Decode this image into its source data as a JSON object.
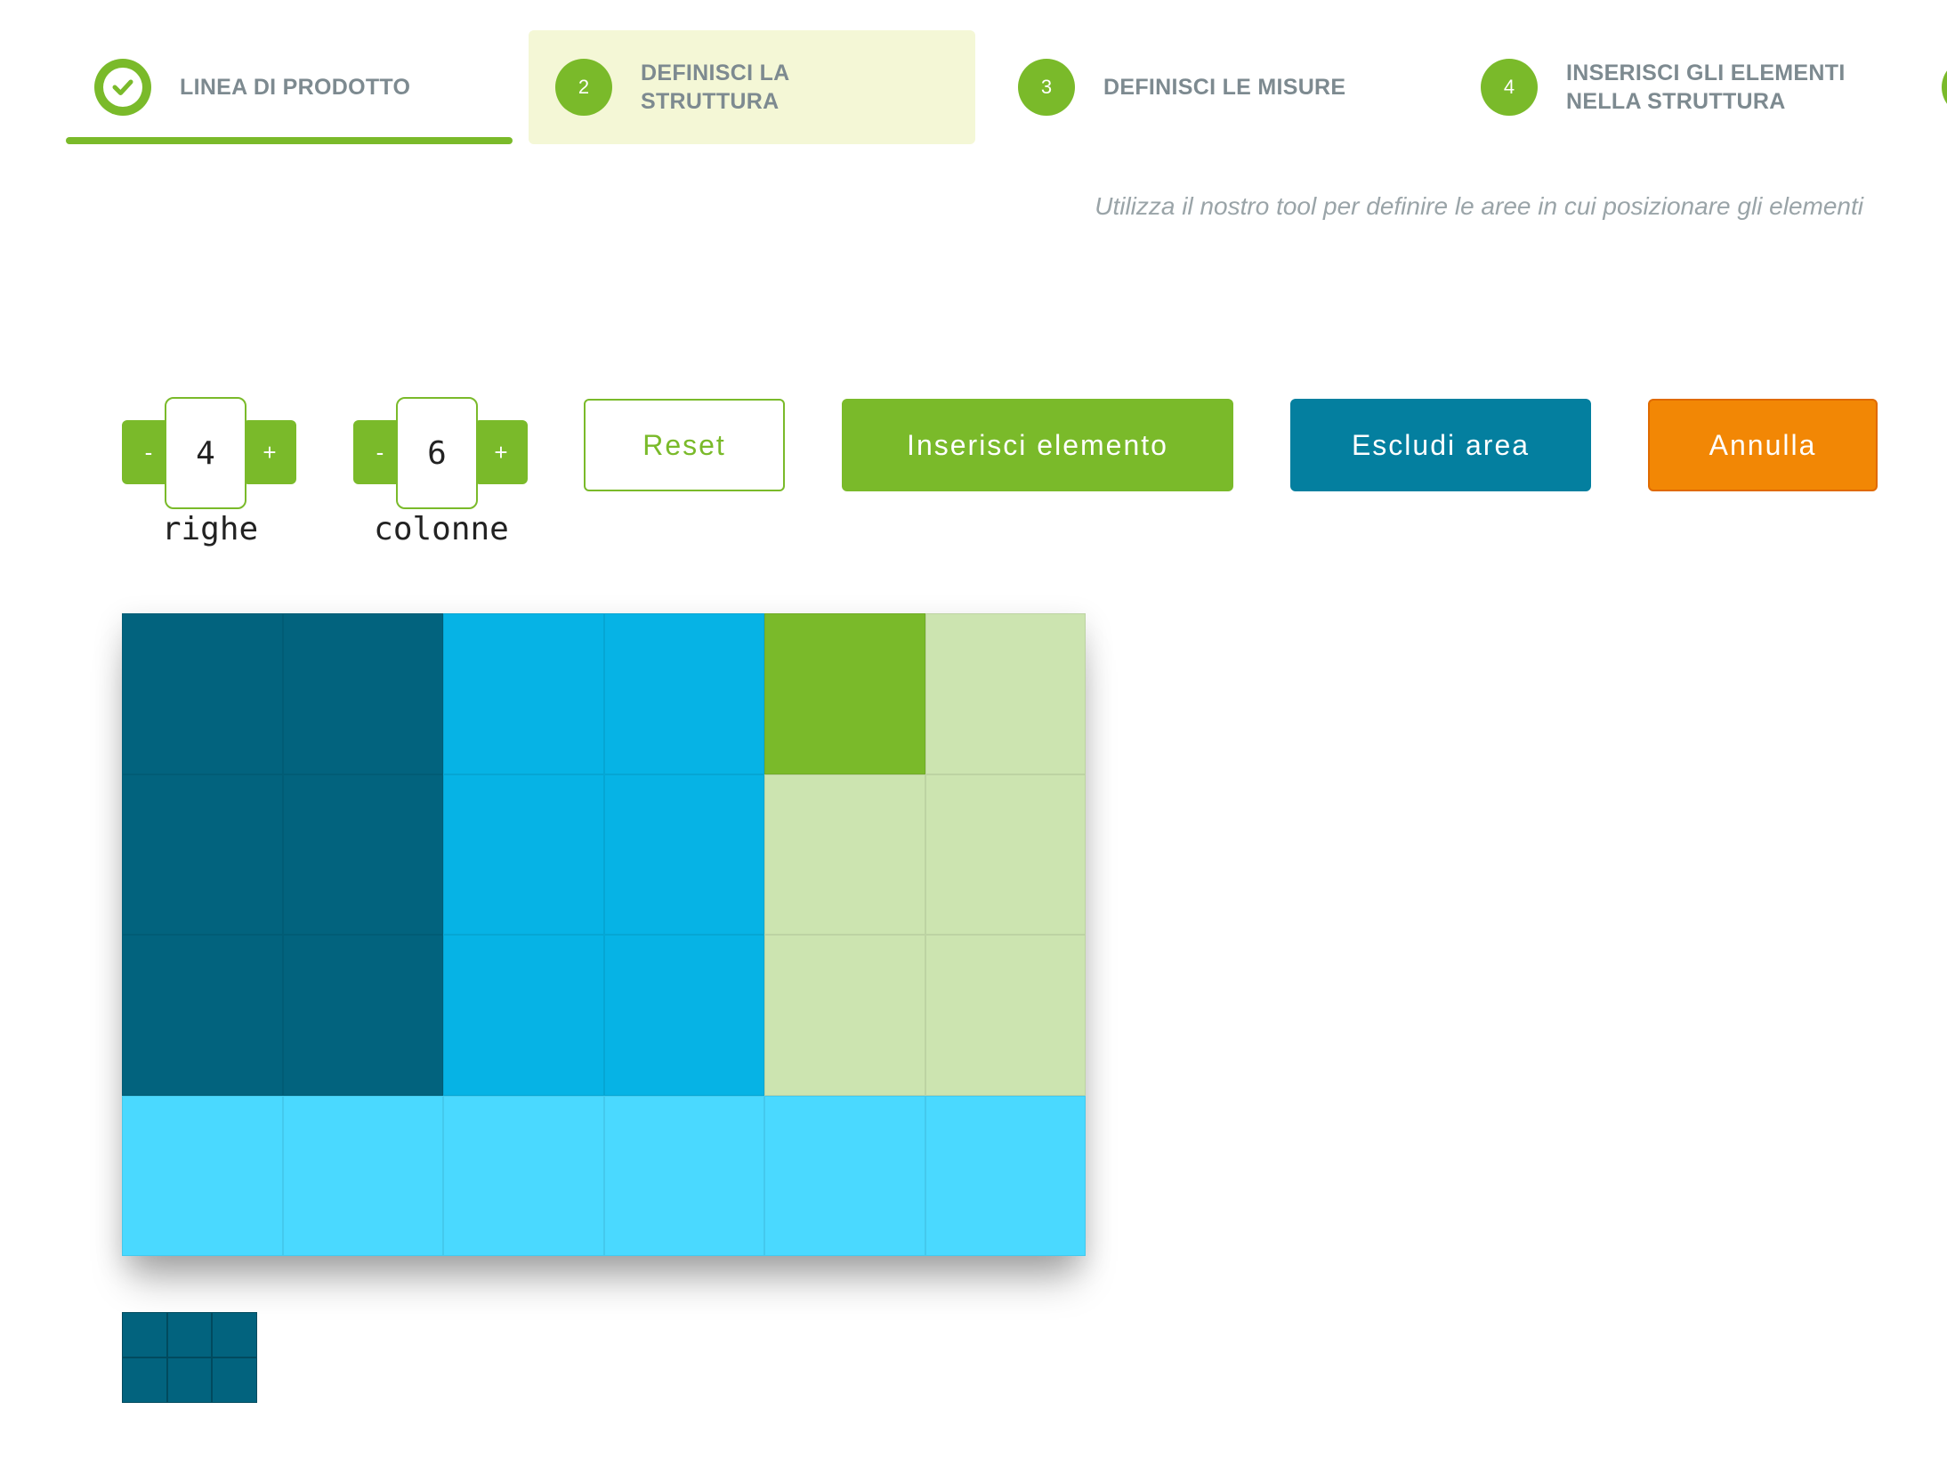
{
  "steps": [
    {
      "number": "",
      "label": "LINEA DI PRODOTTO",
      "state": "done"
    },
    {
      "number": "2",
      "label": "DEFINISCI LA\nSTRUTTURA",
      "state": "active"
    },
    {
      "number": "3",
      "label": "DEFINISCI LE MISURE",
      "state": "pending"
    },
    {
      "number": "4",
      "label": "INSERISCI GLI ELEMENTI\nNELLA STRUTTURA",
      "state": "pending"
    }
  ],
  "subtitle": "Utilizza il nostro tool per definire le aree in cui posizionare gli elementi",
  "rows_counter": {
    "minus": "-",
    "value": "4",
    "plus": "+",
    "label": "righe"
  },
  "cols_counter": {
    "minus": "-",
    "value": "6",
    "plus": "+",
    "label": "colonne"
  },
  "buttons": {
    "reset": "Reset",
    "insert": "Inserisci elemento",
    "exclude": "Escludi area",
    "cancel": "Annulla"
  },
  "colors": {
    "green": "#7aba2a",
    "dark_teal": "#02637e",
    "blue": "#06b3e5",
    "light_blue": "#4ad9ff",
    "pale_green": "#cce4b0",
    "orange": "#f28705",
    "teal_button": "#047f9f"
  },
  "grid": {
    "rows": 4,
    "cols": 6,
    "cells": [
      [
        "dark_teal",
        "dark_teal",
        "blue",
        "blue",
        "green",
        "pale_green"
      ],
      [
        "dark_teal",
        "dark_teal",
        "blue",
        "blue",
        "pale_green",
        "pale_green"
      ],
      [
        "dark_teal",
        "dark_teal",
        "blue",
        "blue",
        "pale_green",
        "pale_green"
      ],
      [
        "light_blue",
        "light_blue",
        "light_blue",
        "light_blue",
        "light_blue",
        "light_blue"
      ]
    ]
  },
  "mini_grid": {
    "rows": 2,
    "cols": 3
  }
}
